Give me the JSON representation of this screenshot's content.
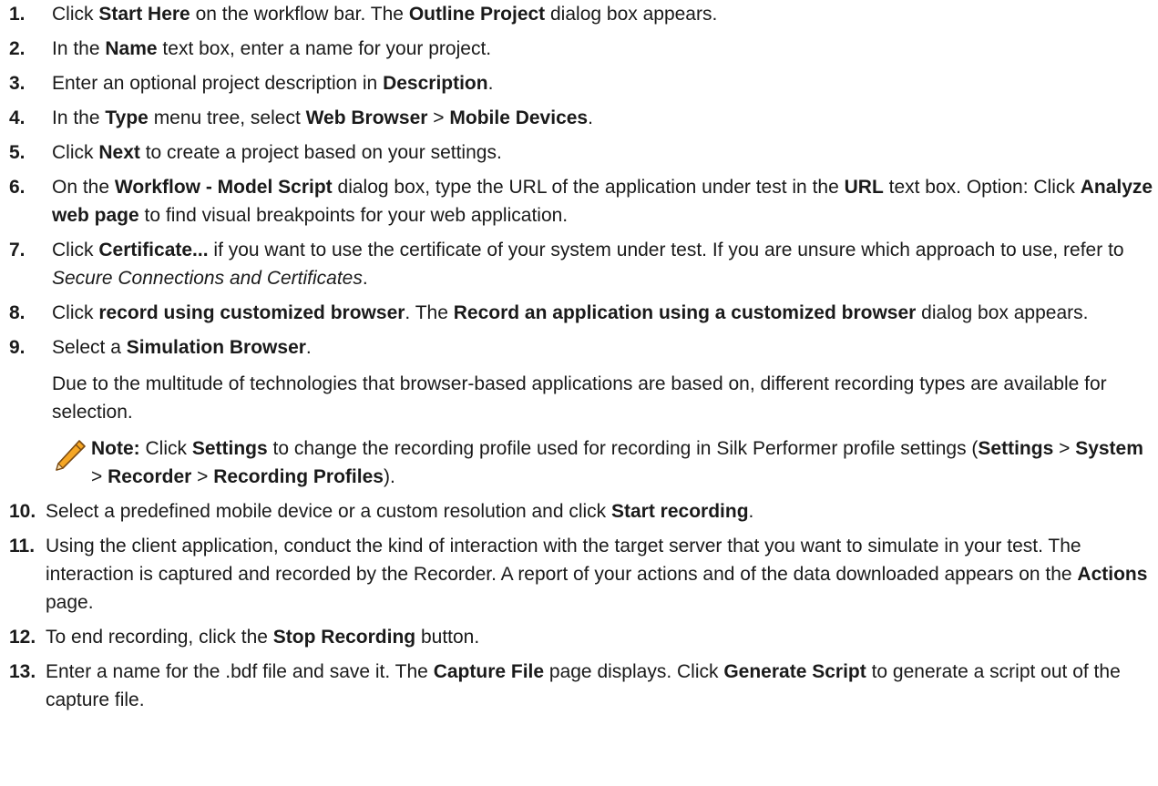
{
  "steps": [
    {
      "num": "1.",
      "parts": [
        {
          "t": "Click "
        },
        {
          "t": "Start Here",
          "b": true
        },
        {
          "t": " on the workflow bar. The "
        },
        {
          "t": "Outline Project",
          "b": true
        },
        {
          "t": " dialog box appears."
        }
      ]
    },
    {
      "num": "2.",
      "parts": [
        {
          "t": "In the "
        },
        {
          "t": "Name",
          "b": true
        },
        {
          "t": " text box, enter a name for your project."
        }
      ]
    },
    {
      "num": "3.",
      "parts": [
        {
          "t": "Enter an optional project description in "
        },
        {
          "t": "Description",
          "b": true
        },
        {
          "t": "."
        }
      ]
    },
    {
      "num": "4.",
      "parts": [
        {
          "t": "In the "
        },
        {
          "t": "Type",
          "b": true
        },
        {
          "t": " menu tree, select "
        },
        {
          "t": "Web Browser",
          "b": true
        },
        {
          "t": " > "
        },
        {
          "t": "Mobile Devices",
          "b": true
        },
        {
          "t": "."
        }
      ]
    },
    {
      "num": "5.",
      "parts": [
        {
          "t": "Click "
        },
        {
          "t": "Next",
          "b": true
        },
        {
          "t": " to create a project based on your settings."
        }
      ]
    },
    {
      "num": "6.",
      "parts": [
        {
          "t": "On the "
        },
        {
          "t": "Workflow - Model Script",
          "b": true
        },
        {
          "t": " dialog box, type the URL of the application under test in the "
        },
        {
          "t": "URL",
          "b": true
        },
        {
          "t": " text box. Option: Click "
        },
        {
          "t": "Analyze web page",
          "b": true
        },
        {
          "t": " to find visual breakpoints for your web application."
        }
      ]
    },
    {
      "num": "7.",
      "parts": [
        {
          "t": "Click "
        },
        {
          "t": "Certificate...",
          "b": true
        },
        {
          "t": " if you want to use the certificate of your system under test. If you are unsure which approach to use, refer to "
        },
        {
          "t": "Secure Connections and Certificates",
          "i": true
        },
        {
          "t": "."
        }
      ]
    },
    {
      "num": "8.",
      "parts": [
        {
          "t": "Click "
        },
        {
          "t": "record using customized browser",
          "b": true
        },
        {
          "t": ". The "
        },
        {
          "t": "Record an application using a customized browser",
          "b": true
        },
        {
          "t": " dialog box appears."
        }
      ]
    },
    {
      "num": "9.",
      "parts": [
        {
          "t": "Select a "
        },
        {
          "t": "Simulation Browser",
          "b": true
        },
        {
          "t": "."
        }
      ],
      "extra": "Due to the multitude of technologies that browser-based applications are based on, different recording types are available for selection.",
      "note": [
        {
          "t": "Note:",
          "b": true
        },
        {
          "t": " Click "
        },
        {
          "t": "Settings",
          "b": true
        },
        {
          "t": " to change the recording profile used for recording in Silk Performer profile settings ("
        },
        {
          "t": "Settings",
          "b": true
        },
        {
          "t": " > "
        },
        {
          "t": "System",
          "b": true
        },
        {
          "t": " > "
        },
        {
          "t": "Recorder",
          "b": true
        },
        {
          "t": " > "
        },
        {
          "t": "Recording Profiles",
          "b": true
        },
        {
          "t": ")."
        }
      ]
    },
    {
      "num": "10.",
      "parts": [
        {
          "t": "Select a predefined mobile device or a custom resolution and click "
        },
        {
          "t": "Start recording",
          "b": true
        },
        {
          "t": "."
        }
      ]
    },
    {
      "num": "11.",
      "parts": [
        {
          "t": "Using the client application, conduct the kind of interaction with the target server that you want to simulate in your test. The interaction is captured and recorded by the Recorder. A report of your actions and of the data downloaded appears on the "
        },
        {
          "t": "Actions",
          "b": true
        },
        {
          "t": " page."
        }
      ]
    },
    {
      "num": "12.",
      "parts": [
        {
          "t": "To end recording, click the "
        },
        {
          "t": "Stop Recording",
          "b": true
        },
        {
          "t": " button."
        }
      ]
    },
    {
      "num": "13.",
      "parts": [
        {
          "t": "Enter a name for the .bdf file and save it. The "
        },
        {
          "t": "Capture File",
          "b": true
        },
        {
          "t": " page displays. Click "
        },
        {
          "t": "Generate Script",
          "b": true
        },
        {
          "t": " to generate a script out of the capture file."
        }
      ]
    }
  ],
  "note_icon": "pencil-icon",
  "colors": {
    "text": "#1a1a1a",
    "pencil_body": "#f5a623",
    "pencil_outline": "#7a4a12"
  }
}
